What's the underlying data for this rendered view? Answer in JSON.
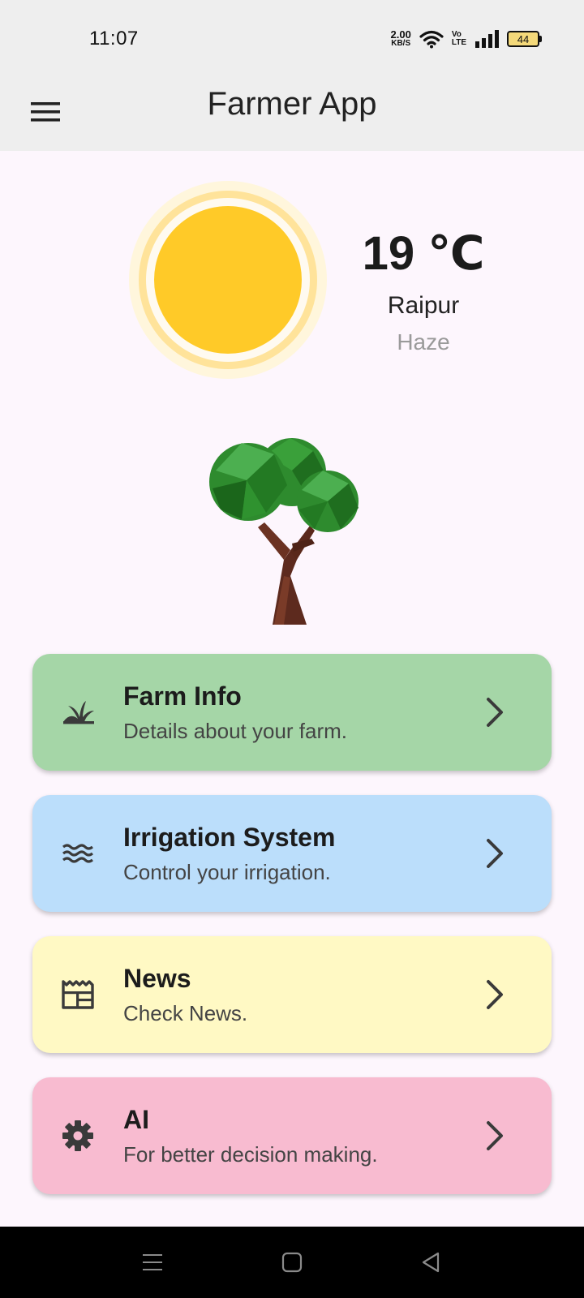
{
  "status_bar": {
    "time": "11:07",
    "net_speed_value": "2.00",
    "net_speed_unit": "KB/S",
    "volte_top": "Vo",
    "volte_bottom": "LTE",
    "battery": "44"
  },
  "app_bar": {
    "title": "Farmer App",
    "menu_icon": "hamburger-menu-icon"
  },
  "weather": {
    "temperature": "19 ℃",
    "city": "Raipur",
    "condition": "Haze",
    "icon": "sun-icon"
  },
  "illustration": "tree-icon",
  "cards": [
    {
      "title": "Farm Info",
      "subtitle": "Details about your farm.",
      "icon": "grass-icon",
      "color": "#a5d6a7"
    },
    {
      "title": "Irrigation System",
      "subtitle": "Control your irrigation.",
      "icon": "waves-icon",
      "color": "#bbdefb"
    },
    {
      "title": "News",
      "subtitle": "Check News.",
      "icon": "newspaper-icon",
      "color": "#fff9c4"
    },
    {
      "title": "AI",
      "subtitle": "For better decision making.",
      "icon": "gear-icon",
      "color": "#f8bbd0"
    }
  ],
  "nav_bar": {
    "recents": "recents-icon",
    "home": "home-icon",
    "back": "back-icon"
  }
}
